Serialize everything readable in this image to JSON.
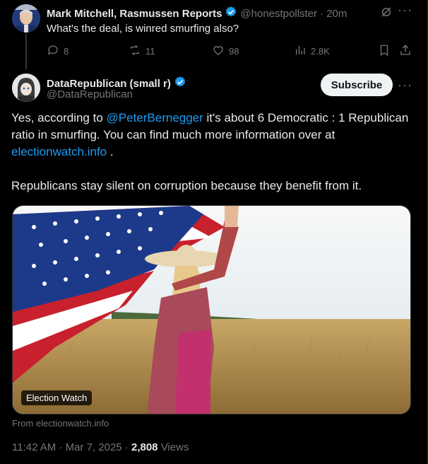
{
  "reply": {
    "author_name": "Mark Mitchell, Rasmussen Reports",
    "author_handle": "@honestpollster",
    "time": "· 20m",
    "text": "What's the deal, is winred smurfing also?",
    "actions": {
      "replies": "8",
      "reposts": "11",
      "likes": "98",
      "views": "2.8K"
    }
  },
  "main": {
    "author_name": "DataRepublican (small r)",
    "author_handle": "@DataRepublican",
    "subscribe_label": "Subscribe",
    "text_part1": "Yes, according to ",
    "mention": "@PeterBernegger",
    "text_part2": " it's about 6 Democratic : 1 Republican ratio in smurfing. You can find much more information over at ",
    "link": "electionwatch.info",
    "text_part3": " .",
    "text_paragraph2": "Republicans stay silent on corruption because they benefit from it.",
    "card_badge": "Election Watch",
    "card_source": "From electionwatch.info",
    "timestamp": "11:42 AM · Mar 7, 2025 · ",
    "views_count": "2,808",
    "views_label": " Views"
  },
  "colors": {
    "background": "#000000",
    "text": "#e7e9ea",
    "muted": "#71767b",
    "link": "#1d9bf0",
    "verified": "#1d9bf0"
  },
  "icons": [
    "grok-icon",
    "more-icon",
    "reply-icon",
    "repost-icon",
    "like-icon",
    "views-icon",
    "bookmark-icon",
    "share-icon",
    "verified-badge-icon"
  ]
}
